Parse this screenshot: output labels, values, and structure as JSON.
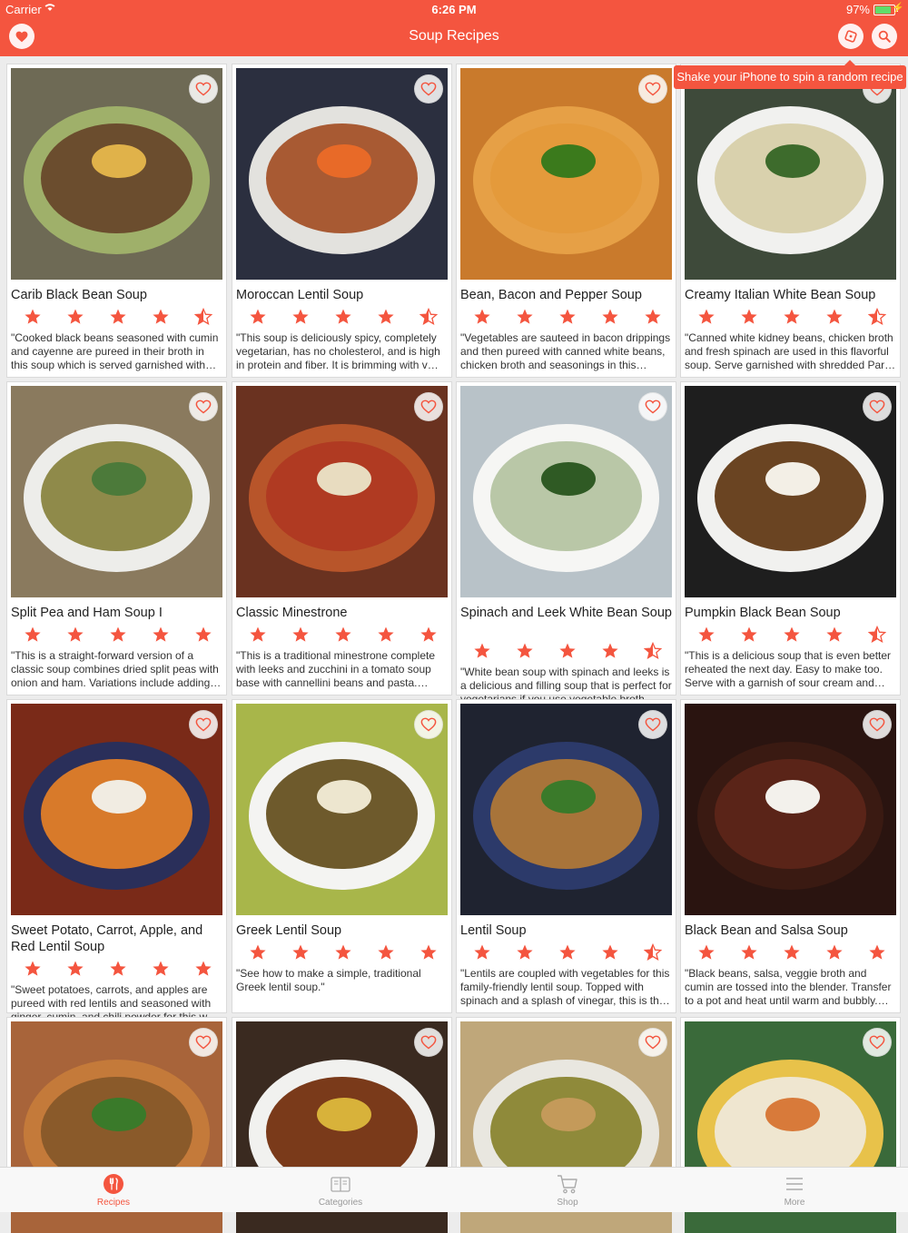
{
  "status_bar": {
    "carrier": "Carrier",
    "time": "6:26 PM",
    "battery": "97%",
    "battery_level": 0.97
  },
  "nav": {
    "title": "Soup Recipes",
    "favorites_icon": "heart-icon",
    "spin_icon": "spin-icon",
    "search_icon": "search-icon"
  },
  "tooltip": {
    "text": "Shake your iPhone to spin a random recipe"
  },
  "colors": {
    "accent": "#f4553f",
    "star": "#f4553f",
    "tab_inactive": "#999999",
    "bar_background": "#f8f8f8"
  },
  "recipes": [
    {
      "title": "Carib Black Bean Soup",
      "rating": 4.5,
      "description": "\"Cooked black beans seasoned with cumin and cayenne are pureed in their broth in this soup which is served garnished with…",
      "photo": {
        "bg": "#6e6a55",
        "rim": "#9fb06a",
        "soup": "#6b4d2e",
        "garnish": "#e0b24a"
      }
    },
    {
      "title": "Moroccan Lentil Soup",
      "rating": 4.5,
      "description": "\"This soup is deliciously spicy, completely vegetarian, has no cholesterol, and is high in protein and fiber.  It is brimming with v…",
      "photo": {
        "bg": "#2b2f3f",
        "rim": "#e3e2de",
        "soup": "#a85a33",
        "garnish": "#e86a28"
      }
    },
    {
      "title": "Bean, Bacon and Pepper Soup",
      "rating": 5,
      "description": "\"Vegetables are sauteed in bacon drippings and then pureed with canned white beans, chicken broth and seasonings in this soup…",
      "photo": {
        "bg": "#c97a2c",
        "rim": "#e6a046",
        "soup": "#e49a3b",
        "garnish": "#3b7a1c"
      }
    },
    {
      "title": "Creamy Italian White Bean Soup",
      "rating": 4.5,
      "description": "\"Canned white kidney beans, chicken broth and fresh spinach are used in this flavorful soup.  Serve garnished with shredded Par…",
      "photo": {
        "bg": "#3e4a3a",
        "rim": "#f1f1ef",
        "soup": "#d9d1ad",
        "garnish": "#3d6b2c"
      }
    },
    {
      "title": "Split Pea and Ham Soup I",
      "rating": 5,
      "description": "\"This is a straight-forward version of a classic soup combines dried split peas with onion and ham.  Variations include adding…",
      "photo": {
        "bg": "#8a7a5e",
        "rim": "#ededea",
        "soup": "#8f8a4a",
        "garnish": "#4c7a3a"
      }
    },
    {
      "title": "Classic Minestrone",
      "rating": 5,
      "description": "\"This is a traditional minestrone complete with leeks and zucchini in a tomato soup base with cannellini beans and pasta.  Ser…",
      "photo": {
        "bg": "#6a3220",
        "rim": "#b8552a",
        "soup": "#b03a22",
        "garnish": "#e8dcc0"
      }
    },
    {
      "title": "Spinach and Leek White Bean Soup",
      "rating": 4.5,
      "description": "\"White bean soup with spinach and leeks is a delicious and filling soup that is perfect for vegetarians if you use vegetable broth…",
      "photo": {
        "bg": "#b8c2c8",
        "rim": "#f6f6f4",
        "soup": "#b9c7a7",
        "garnish": "#2f5a24"
      }
    },
    {
      "title": "Pumpkin Black Bean Soup",
      "rating": 4.5,
      "description": "\"This is a delicious soup that is even better reheated the next day. Easy to make too. Serve with a garnish of sour cream and to…",
      "photo": {
        "bg": "#1e1e1e",
        "rim": "#f1f1ef",
        "soup": "#6a4422",
        "garnish": "#f3efe6"
      }
    },
    {
      "title": "Sweet Potato, Carrot, Apple, and Red Lentil Soup",
      "rating": 5,
      "description": "\"Sweet potatoes, carrots, and apples are pureed with red lentils and seasoned with ginger, cumin, and chili powder for this w…",
      "photo": {
        "bg": "#7a2a18",
        "rim": "#2a2f5a",
        "soup": "#d87a2a",
        "garnish": "#f1ece2"
      }
    },
    {
      "title": "Greek Lentil Soup",
      "rating": 5,
      "description": "\"See how to make a simple, traditional Greek lentil soup.\"",
      "photo": {
        "bg": "#a8b64a",
        "rim": "#f4f4f2",
        "soup": "#6e5a2c",
        "garnish": "#ede6cf"
      }
    },
    {
      "title": "Lentil Soup",
      "rating": 4.5,
      "description": "\"Lentils are coupled with vegetables for this family-friendly lentil soup. Topped with spinach and a splash of vinegar, this is th…",
      "photo": {
        "bg": "#1f2330",
        "rim": "#2c3a6a",
        "soup": "#a8743a",
        "garnish": "#3a7a2a"
      }
    },
    {
      "title": "Black Bean and Salsa Soup",
      "rating": 5,
      "description": "\"Black beans, salsa, veggie broth and cumin are tossed into the blender. Transfer to a pot and heat until warm and bubbly. Serv…",
      "photo": {
        "bg": "#2a1410",
        "rim": "#3a1a12",
        "soup": "#5a2418",
        "garnish": "#f3f1ec"
      }
    },
    {
      "title": "",
      "rating": 0,
      "description": "",
      "photo": {
        "bg": "#a8643a",
        "rim": "#c47a3a",
        "soup": "#8a5a2a",
        "garnish": "#3a7a2a"
      }
    },
    {
      "title": "",
      "rating": 0,
      "description": "",
      "photo": {
        "bg": "#3a2a20",
        "rim": "#f1f1ef",
        "soup": "#7a3a1a",
        "garnish": "#d8b23a"
      }
    },
    {
      "title": "",
      "rating": 0,
      "description": "",
      "photo": {
        "bg": "#bfa77a",
        "rim": "#e9e7e0",
        "soup": "#8f8a3a",
        "garnish": "#c49a5a"
      }
    },
    {
      "title": "",
      "rating": 0,
      "description": "",
      "photo": {
        "bg": "#3a6a3a",
        "rim": "#e8c24a",
        "soup": "#efe6d0",
        "garnish": "#d87a3a"
      }
    }
  ],
  "tabs": [
    {
      "label": "Recipes",
      "icon": "utensils-icon",
      "active": true
    },
    {
      "label": "Categories",
      "icon": "book-icon",
      "active": false
    },
    {
      "label": "Shop",
      "icon": "cart-icon",
      "active": false
    },
    {
      "label": "More",
      "icon": "menu-icon",
      "active": false
    }
  ]
}
